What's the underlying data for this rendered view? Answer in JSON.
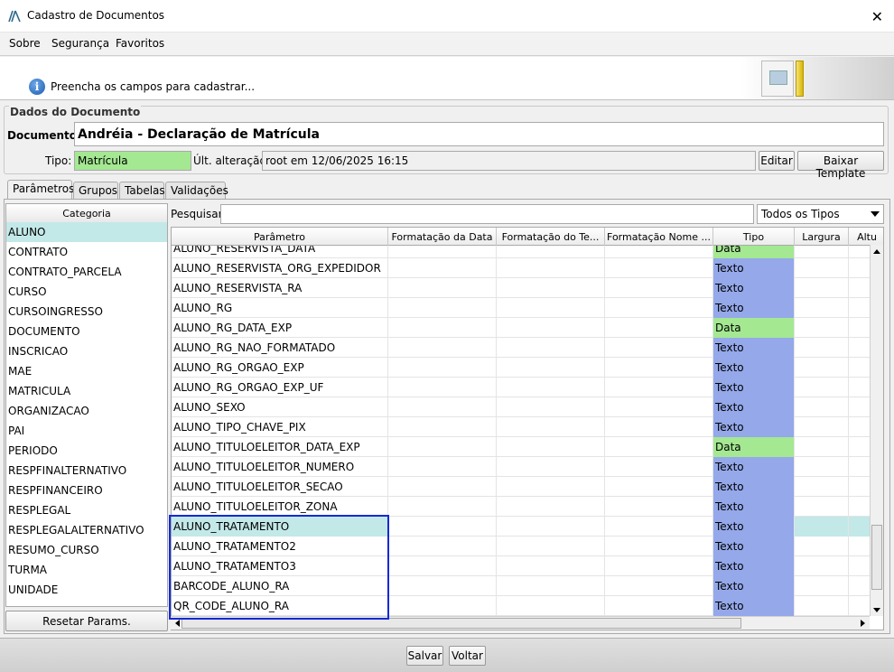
{
  "window": {
    "title": "Cadastro de Documentos",
    "close_glyph": "✕",
    "app_icon": "app-logo-icon"
  },
  "menu": [
    {
      "label": "Sobre"
    },
    {
      "label": "Segurança"
    },
    {
      "label": "Favoritos"
    }
  ],
  "info": {
    "icon": "info-icon",
    "icon_glyph": "i",
    "text": "Preencha os campos para cadastrar..."
  },
  "dados": {
    "legend": "Dados do Documento",
    "documento_label": "Documento:",
    "documento_value": "Andréia - Declaração de Matrícula",
    "tipo_label": "Tipo:",
    "tipo_value": "Matrícula",
    "ult_label": "Últ. alteração:",
    "ult_value": "root em 12/06/2025 16:15",
    "editar_label": "Editar",
    "baixar_label": "Baixar Template"
  },
  "tabs": [
    {
      "label": "Parâmetros",
      "active": true
    },
    {
      "label": "Grupos"
    },
    {
      "label": "Tabelas"
    },
    {
      "label": "Validações"
    }
  ],
  "categoria": {
    "header": "Categoria",
    "items": [
      "ALUNO",
      "CONTRATO",
      "CONTRATO_PARCELA",
      "CURSO",
      "CURSOINGRESSO",
      "DOCUMENTO",
      "INSCRICAO",
      "MAE",
      "MATRICULA",
      "ORGANIZACAO",
      "PAI",
      "PERIODO",
      "RESPFINALTERNATIVO",
      "RESPFINANCEIRO",
      "RESPLEGAL",
      "RESPLEGALALTERNATIVO",
      "RESUMO_CURSO",
      "TURMA",
      "UNIDADE"
    ],
    "selected": "ALUNO",
    "reset_label": "Resetar Params."
  },
  "search": {
    "label": "Pesquisar:",
    "value": "",
    "type_filter": "Todos os Tipos"
  },
  "grid": {
    "columns": [
      "Parâmetro",
      "Formatação da Data",
      "Formatação do Te...",
      "Formatação Nome ...",
      "Tipo",
      "Largura",
      "Altu"
    ],
    "rows": [
      {
        "param": "ALUNO_RESERVISTA_DATA",
        "tipo": "Data"
      },
      {
        "param": "ALUNO_RESERVISTA_ORG_EXPEDIDOR",
        "tipo": "Texto"
      },
      {
        "param": "ALUNO_RESERVISTA_RA",
        "tipo": "Texto"
      },
      {
        "param": "ALUNO_RG",
        "tipo": "Texto"
      },
      {
        "param": "ALUNO_RG_DATA_EXP",
        "tipo": "Data"
      },
      {
        "param": "ALUNO_RG_NAO_FORMATADO",
        "tipo": "Texto"
      },
      {
        "param": "ALUNO_RG_ORGAO_EXP",
        "tipo": "Texto"
      },
      {
        "param": "ALUNO_RG_ORGAO_EXP_UF",
        "tipo": "Texto"
      },
      {
        "param": "ALUNO_SEXO",
        "tipo": "Texto"
      },
      {
        "param": "ALUNO_TIPO_CHAVE_PIX",
        "tipo": "Texto"
      },
      {
        "param": "ALUNO_TITULOELEITOR_DATA_EXP",
        "tipo": "Data"
      },
      {
        "param": "ALUNO_TITULOELEITOR_NUMERO",
        "tipo": "Texto"
      },
      {
        "param": "ALUNO_TITULOELEITOR_SECAO",
        "tipo": "Texto"
      },
      {
        "param": "ALUNO_TITULOELEITOR_ZONA",
        "tipo": "Texto"
      },
      {
        "param": "ALUNO_TRATAMENTO",
        "tipo": "Texto",
        "selected": true
      },
      {
        "param": "ALUNO_TRATAMENTO2",
        "tipo": "Texto"
      },
      {
        "param": "ALUNO_TRATAMENTO3",
        "tipo": "Texto"
      },
      {
        "param": "BARCODE_ALUNO_RA",
        "tipo": "Texto"
      },
      {
        "param": "QR_CODE_ALUNO_RA",
        "tipo": "Texto"
      }
    ]
  },
  "actions": {
    "salvar_label": "Salvar",
    "voltar_label": "Voltar"
  },
  "colors": {
    "texto": "#94a8ea",
    "data": "#a4e892",
    "selected": "#c3e8e8",
    "highlight": "#1428d8"
  }
}
